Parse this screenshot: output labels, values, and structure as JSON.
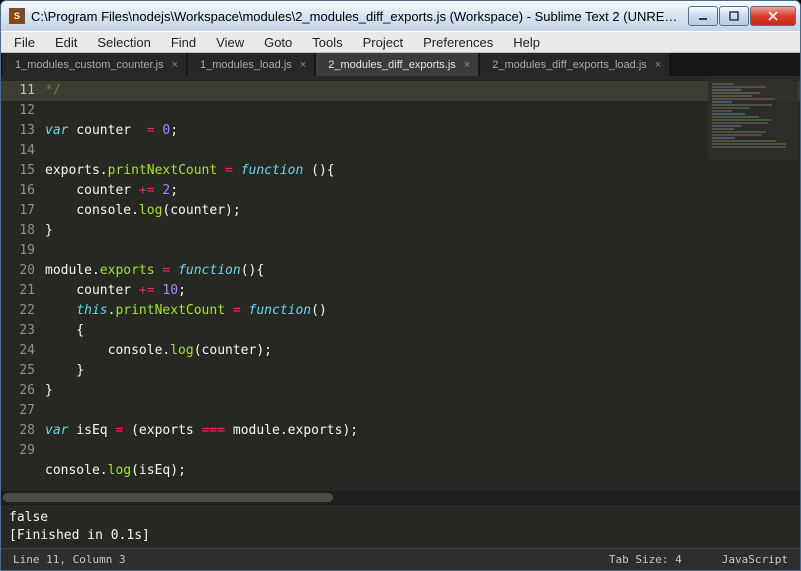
{
  "window": {
    "title": "C:\\Program Files\\nodejs\\Workspace\\modules\\2_modules_diff_exports.js (Workspace) - Sublime Text 2 (UNREGIST..."
  },
  "menu": {
    "items": [
      "File",
      "Edit",
      "Selection",
      "Find",
      "View",
      "Goto",
      "Tools",
      "Project",
      "Preferences",
      "Help"
    ]
  },
  "tabs": {
    "items": [
      {
        "label": "1_modules_custom_counter.js",
        "active": false
      },
      {
        "label": "1_modules_load.js",
        "active": false
      },
      {
        "label": "2_modules_diff_exports.js",
        "active": true
      },
      {
        "label": "2_modules_diff_exports_load.js",
        "active": false
      }
    ]
  },
  "editor": {
    "first_line_no": 11,
    "lines": [
      {
        "n": 11,
        "cur": true,
        "seg": [
          {
            "c": "cmt",
            "t": "*/"
          }
        ]
      },
      {
        "n": 12,
        "seg": [
          {
            "c": "st",
            "t": "var"
          },
          {
            "t": " counter  "
          },
          {
            "c": "op",
            "t": "="
          },
          {
            "t": " "
          },
          {
            "c": "num",
            "t": "0"
          },
          {
            "t": ";"
          }
        ]
      },
      {
        "n": 13,
        "seg": []
      },
      {
        "n": 14,
        "seg": [
          {
            "t": "exports."
          },
          {
            "c": "fn",
            "t": "printNextCount"
          },
          {
            "t": " "
          },
          {
            "c": "op",
            "t": "="
          },
          {
            "t": " "
          },
          {
            "c": "st",
            "t": "function"
          },
          {
            "t": " (){"
          }
        ]
      },
      {
        "n": 15,
        "seg": [
          {
            "t": "    counter "
          },
          {
            "c": "op",
            "t": "+="
          },
          {
            "t": " "
          },
          {
            "c": "num",
            "t": "2"
          },
          {
            "t": ";"
          }
        ]
      },
      {
        "n": 16,
        "seg": [
          {
            "t": "    console."
          },
          {
            "c": "fn",
            "t": "log"
          },
          {
            "t": "(counter);"
          }
        ]
      },
      {
        "n": 17,
        "seg": [
          {
            "t": "}"
          }
        ]
      },
      {
        "n": 18,
        "seg": []
      },
      {
        "n": 19,
        "seg": [
          {
            "t": "module."
          },
          {
            "c": "fn",
            "t": "exports"
          },
          {
            "t": " "
          },
          {
            "c": "op",
            "t": "="
          },
          {
            "t": " "
          },
          {
            "c": "st",
            "t": "function"
          },
          {
            "t": "(){"
          }
        ]
      },
      {
        "n": 20,
        "seg": [
          {
            "t": "    counter "
          },
          {
            "c": "op",
            "t": "+="
          },
          {
            "t": " "
          },
          {
            "c": "num",
            "t": "10"
          },
          {
            "t": ";"
          }
        ]
      },
      {
        "n": 21,
        "seg": [
          {
            "t": "    "
          },
          {
            "c": "st",
            "t": "this"
          },
          {
            "t": "."
          },
          {
            "c": "fn",
            "t": "printNextCount"
          },
          {
            "t": " "
          },
          {
            "c": "op",
            "t": "="
          },
          {
            "t": " "
          },
          {
            "c": "st",
            "t": "function"
          },
          {
            "t": "()"
          }
        ]
      },
      {
        "n": 22,
        "seg": [
          {
            "t": "    {"
          }
        ]
      },
      {
        "n": 23,
        "seg": [
          {
            "t": "        console."
          },
          {
            "c": "fn",
            "t": "log"
          },
          {
            "t": "(counter);"
          }
        ]
      },
      {
        "n": 24,
        "seg": [
          {
            "t": "    }"
          }
        ]
      },
      {
        "n": 25,
        "seg": [
          {
            "t": "}"
          }
        ]
      },
      {
        "n": 26,
        "seg": []
      },
      {
        "n": 27,
        "seg": [
          {
            "c": "st",
            "t": "var"
          },
          {
            "t": " isEq "
          },
          {
            "c": "op",
            "t": "="
          },
          {
            "t": " (exports "
          },
          {
            "c": "op",
            "t": "==="
          },
          {
            "t": " module.exports);"
          }
        ]
      },
      {
        "n": 28,
        "seg": []
      },
      {
        "n": 29,
        "seg": [
          {
            "t": "console."
          },
          {
            "c": "fn",
            "t": "log"
          },
          {
            "t": "(isEq);"
          }
        ]
      }
    ]
  },
  "console": {
    "lines": [
      "false",
      "[Finished in 0.1s]"
    ]
  },
  "status": {
    "left": "Line 11, Column 3",
    "tabsize": "Tab Size: 4",
    "syntax": "JavaScript"
  }
}
